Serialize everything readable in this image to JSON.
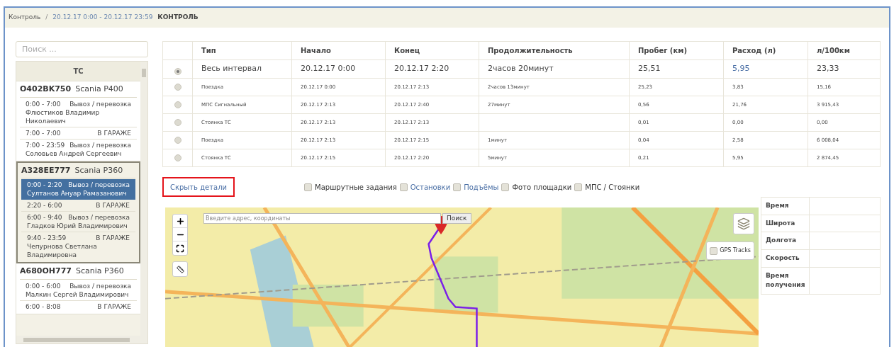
{
  "breadcrumb": {
    "items": [
      "Контроль",
      "20.12.17 0:00 - 20.12.17 23:59"
    ],
    "separator": "/",
    "title": "КОНТРОЛЬ"
  },
  "sidebar": {
    "search": {
      "placeholder": "Поиск ..."
    },
    "header": "ТС",
    "vehicles": [
      {
        "plate": "O402BK750",
        "model": "Scania P400",
        "selected": false,
        "trips": [
          {
            "time": "0:00 - 7:00",
            "kind": "Вывоз / перевозка",
            "driver": "Флюстиков Владимир Николаевич",
            "selected": false
          },
          {
            "time": "7:00 - 7:00",
            "kind": "В ГАРАЖЕ",
            "selected": false
          },
          {
            "time": "7:00 - 23:59",
            "kind": "Вывоз / перевозка",
            "driver": "Соловьев Андрей Сергеевич",
            "selected": false
          }
        ]
      },
      {
        "plate": "A328EE777",
        "model": "Scania P360",
        "selected": true,
        "trips": [
          {
            "time": "0:00 - 2:20",
            "kind": "Вывоз / перевозка",
            "driver": "Султанов Ануар Рамазанович",
            "selected": true
          },
          {
            "time": "2:20 - 6:00",
            "kind": "В ГАРАЖЕ",
            "selected": false
          },
          {
            "time": "6:00 - 9:40",
            "kind": "Вывоз / перевозка",
            "driver": "Гладков Юрий Владимирович",
            "selected": false
          },
          {
            "time": "9:40 - 23:59",
            "kind": "В ГАРАЖЕ",
            "driver": "Чепурнова Светлана Владимировна",
            "selected": false
          }
        ]
      },
      {
        "plate": "A680OH777",
        "model": "Scania P360",
        "selected": false,
        "trips": [
          {
            "time": "0:00 - 6:00",
            "kind": "Вывоз / перевозка",
            "driver": "Малкин Сергей Владимирович",
            "selected": false
          },
          {
            "time": "6:00 - 8:08",
            "kind": "В ГАРАЖЕ",
            "selected": false
          }
        ]
      }
    ]
  },
  "table": {
    "columns": [
      "Тип",
      "Начало",
      "Конец",
      "Продолжительность",
      "Пробег (км)",
      "Расход (л)",
      "л/100км"
    ],
    "rows": [
      {
        "kind": "total",
        "selected": true,
        "fuel_link": true,
        "cells": [
          "Весь интервал",
          "20.12.17 0:00",
          "20.12.17 2:20",
          "2часов 20минут",
          "25,51",
          "5,95",
          "23,33"
        ]
      },
      {
        "kind": "segment",
        "selected": false,
        "fuel_link": false,
        "cells": [
          "Поездка",
          "20.12.17 0:00",
          "20.12.17 2:13",
          "2часов 13минут",
          "25,23",
          "3,83",
          "15,16"
        ]
      },
      {
        "kind": "segment",
        "selected": false,
        "fuel_link": false,
        "cells": [
          "МПС Сигнальный",
          "20.12.17 2:13",
          "20.12.17 2:40",
          "27минут",
          "0,56",
          "21,76",
          "3 915,43"
        ]
      },
      {
        "kind": "segment",
        "selected": false,
        "fuel_link": false,
        "cells": [
          "Стоянка ТС",
          "20.12.17 2:13",
          "20.12.17 2:13",
          "",
          "0,01",
          "0,00",
          "0,00"
        ]
      },
      {
        "kind": "segment",
        "selected": false,
        "fuel_link": false,
        "cells": [
          "Поездка",
          "20.12.17 2:13",
          "20.12.17 2:15",
          "1минут",
          "0,04",
          "2,58",
          "6 008,04"
        ]
      },
      {
        "kind": "segment",
        "selected": false,
        "fuel_link": false,
        "cells": [
          "Стоянка ТС",
          "20.12.17 2:15",
          "20.12.17 2:20",
          "5минут",
          "0,21",
          "5,95",
          "2 874,45"
        ]
      }
    ]
  },
  "details_link": "Скрыть детали",
  "filters": [
    {
      "label": "Маршрутные задания",
      "checked": false,
      "link": false
    },
    {
      "label": "Остановки",
      "checked": false,
      "link": true
    },
    {
      "label": "Подъёмы",
      "checked": false,
      "link": true
    },
    {
      "label": "Фото площадки",
      "checked": false,
      "link": false
    },
    {
      "label": "МПС / Стоянки",
      "checked": false,
      "link": false
    }
  ],
  "map": {
    "search": {
      "placeholder": "Введите адрес, координаты"
    },
    "search_button": "Поиск",
    "gps_tracks": {
      "label": "GPS Tracks",
      "checked": false
    }
  },
  "info": {
    "rows": [
      "Время",
      "Широта",
      "Долгота",
      "Скорость",
      "Время получения"
    ]
  }
}
